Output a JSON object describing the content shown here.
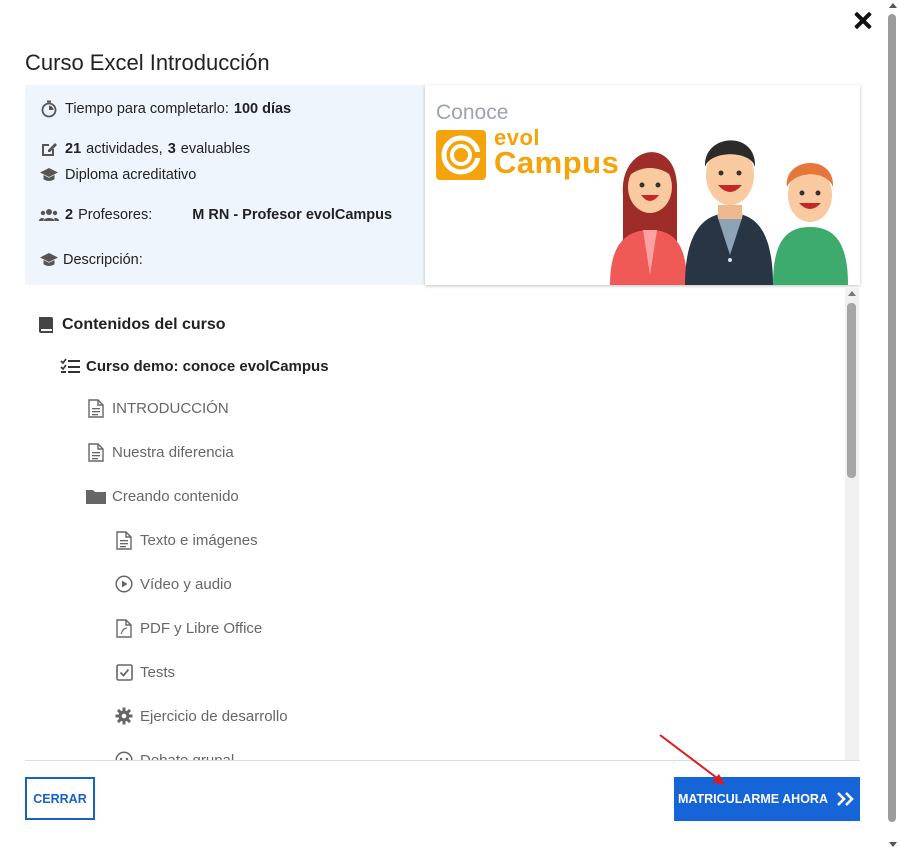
{
  "modal": {
    "title": "Curso Excel Introducción"
  },
  "info": {
    "time_label": "Tiempo para completarlo:",
    "time_value": "100 días",
    "activities_count": "21",
    "activities_label": "actividades,",
    "evaluables_count": "3",
    "evaluables_label": "evaluables",
    "diploma": "Diploma acreditativo",
    "teachers_count": "2",
    "teachers_label": "Profesores:",
    "teacher_name": "M RN - Profesor evolCampus",
    "description_label": "Descripción:"
  },
  "banner": {
    "conoce": "Conoce",
    "brand_top": "evol",
    "brand_bottom": "Campus"
  },
  "contents": {
    "heading": "Contenidos del curso",
    "module": "Curso demo: conoce evolCampus",
    "items": [
      {
        "label": "INTRODUCCIÓN",
        "icon": "document-icon"
      },
      {
        "label": "Nuestra diferencia",
        "icon": "document-icon"
      },
      {
        "label": "Creando contenido",
        "icon": "folder-icon"
      },
      {
        "label": "Texto e imágenes",
        "icon": "document-icon"
      },
      {
        "label": "Vídeo y audio",
        "icon": "play-icon"
      },
      {
        "label": "PDF y Libre Office",
        "icon": "pdf-icon"
      },
      {
        "label": "Tests",
        "icon": "checkbox-icon"
      },
      {
        "label": "Ejercicio de desarrollo",
        "icon": "gear-icon"
      },
      {
        "label": "Debate grupal",
        "icon": "chat-icon"
      }
    ]
  },
  "footer": {
    "close_label": "CERRAR",
    "enroll_label": "MATRICULARME AHORA"
  },
  "colors": {
    "primary": "#1565d8",
    "info_bg": "#eef5fd",
    "brand_orange": "#f5a30a",
    "annotation_red": "#e0191e"
  }
}
